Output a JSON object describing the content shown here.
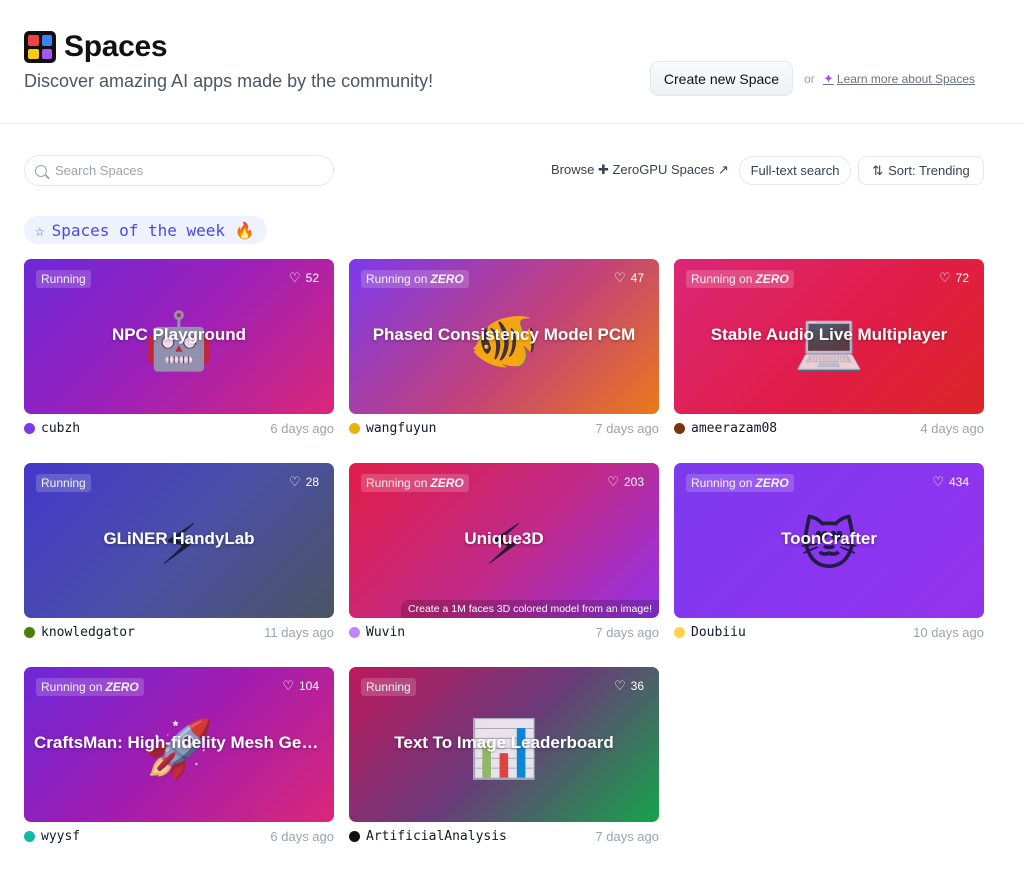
{
  "header": {
    "title": "Spaces",
    "subtitle": "Discover amazing AI apps made by the community!",
    "create_button": "Create new Space",
    "or_text": "or",
    "learn_link": "Learn more about Spaces"
  },
  "toolbar": {
    "search_placeholder": "Search Spaces",
    "browse_label": "Browse ✚ ZeroGPU Spaces ↗",
    "fulltext_label": "Full-text search",
    "sort_label": "Sort:  Trending"
  },
  "section": {
    "title": "Spaces of the week 🔥"
  },
  "cards": [
    {
      "status": "Running",
      "zero": "",
      "likes": "52",
      "title": "NPC Playground",
      "emoji": "🤖",
      "author": "cubzh",
      "time": "6 days ago",
      "desc": "",
      "gradient": "linear-gradient(135deg, #6d28d9 0%, #9d20b8 50%, #db2777 100%)",
      "avatar_color": "#7c3aed"
    },
    {
      "status": "Running on",
      "zero": "ZERO",
      "likes": "47",
      "title": "Phased Consistency Model PCM",
      "emoji": "🐠",
      "author": "wangfuyun",
      "time": "7 days ago",
      "desc": "",
      "gradient": "linear-gradient(135deg, #7c3aed 0%, #c2417a 55%, #ea7a1a 100%)",
      "avatar_color": "#eab308"
    },
    {
      "status": "Running on",
      "zero": "ZERO",
      "likes": "72",
      "title": "Stable Audio Live Multiplayer",
      "emoji": "💻",
      "author": "ameerazam08",
      "time": "4 days ago",
      "desc": "",
      "gradient": "linear-gradient(135deg, #db2777 0%, #e11d48 55%, #dc2626 100%)",
      "avatar_color": "#78350f"
    },
    {
      "status": "Running",
      "zero": "",
      "likes": "28",
      "title": "GLiNER HandyLab",
      "emoji": "⚡",
      "author": "knowledgator",
      "time": "11 days ago",
      "desc": "",
      "gradient": "linear-gradient(135deg, #4338ca 0%, #4b4fa8 50%, #4b5563 100%)",
      "avatar_color": "#4d7c0f"
    },
    {
      "status": "Running on",
      "zero": "ZERO",
      "likes": "203",
      "title": "Unique3D",
      "emoji": "⚡",
      "author": "Wuvin",
      "time": "7 days ago",
      "desc": "Create a 1M faces 3D colored model from an image!",
      "gradient": "linear-gradient(135deg, #e11d48 0%, #c02a8a 55%, #9333ea 100%)",
      "avatar_color": "#c084fc"
    },
    {
      "status": "Running on",
      "zero": "ZERO",
      "likes": "434",
      "title": "ToonCrafter",
      "emoji": "😻",
      "author": "Doubiiu",
      "time": "10 days ago",
      "desc": "",
      "gradient": "linear-gradient(135deg, #7c3aed 0%, #8b35f0 60%, #9333ea 100%)",
      "avatar_color": "#fcd34d"
    },
    {
      "status": "Running on",
      "zero": "ZERO",
      "likes": "104",
      "title": "CraftsMan: High-fidelity Mesh Generati...",
      "emoji": "🚀",
      "author": "wyysf",
      "time": "6 days ago",
      "desc": "",
      "gradient": "linear-gradient(135deg, #6d28d9 0%, #a21caf 50%, #db2777 100%)",
      "avatar_color": "#14b8a6"
    },
    {
      "status": "Running",
      "zero": "",
      "likes": "36",
      "title": "Text To Image Leaderboard",
      "emoji": "📊",
      "author": "ArtificialAnalysis",
      "time": "7 days ago",
      "desc": "",
      "gradient": "linear-gradient(135deg, #be185d 0%, #6b3a7a 50%, #16a34a 100%)",
      "avatar_color": "#111111"
    }
  ]
}
